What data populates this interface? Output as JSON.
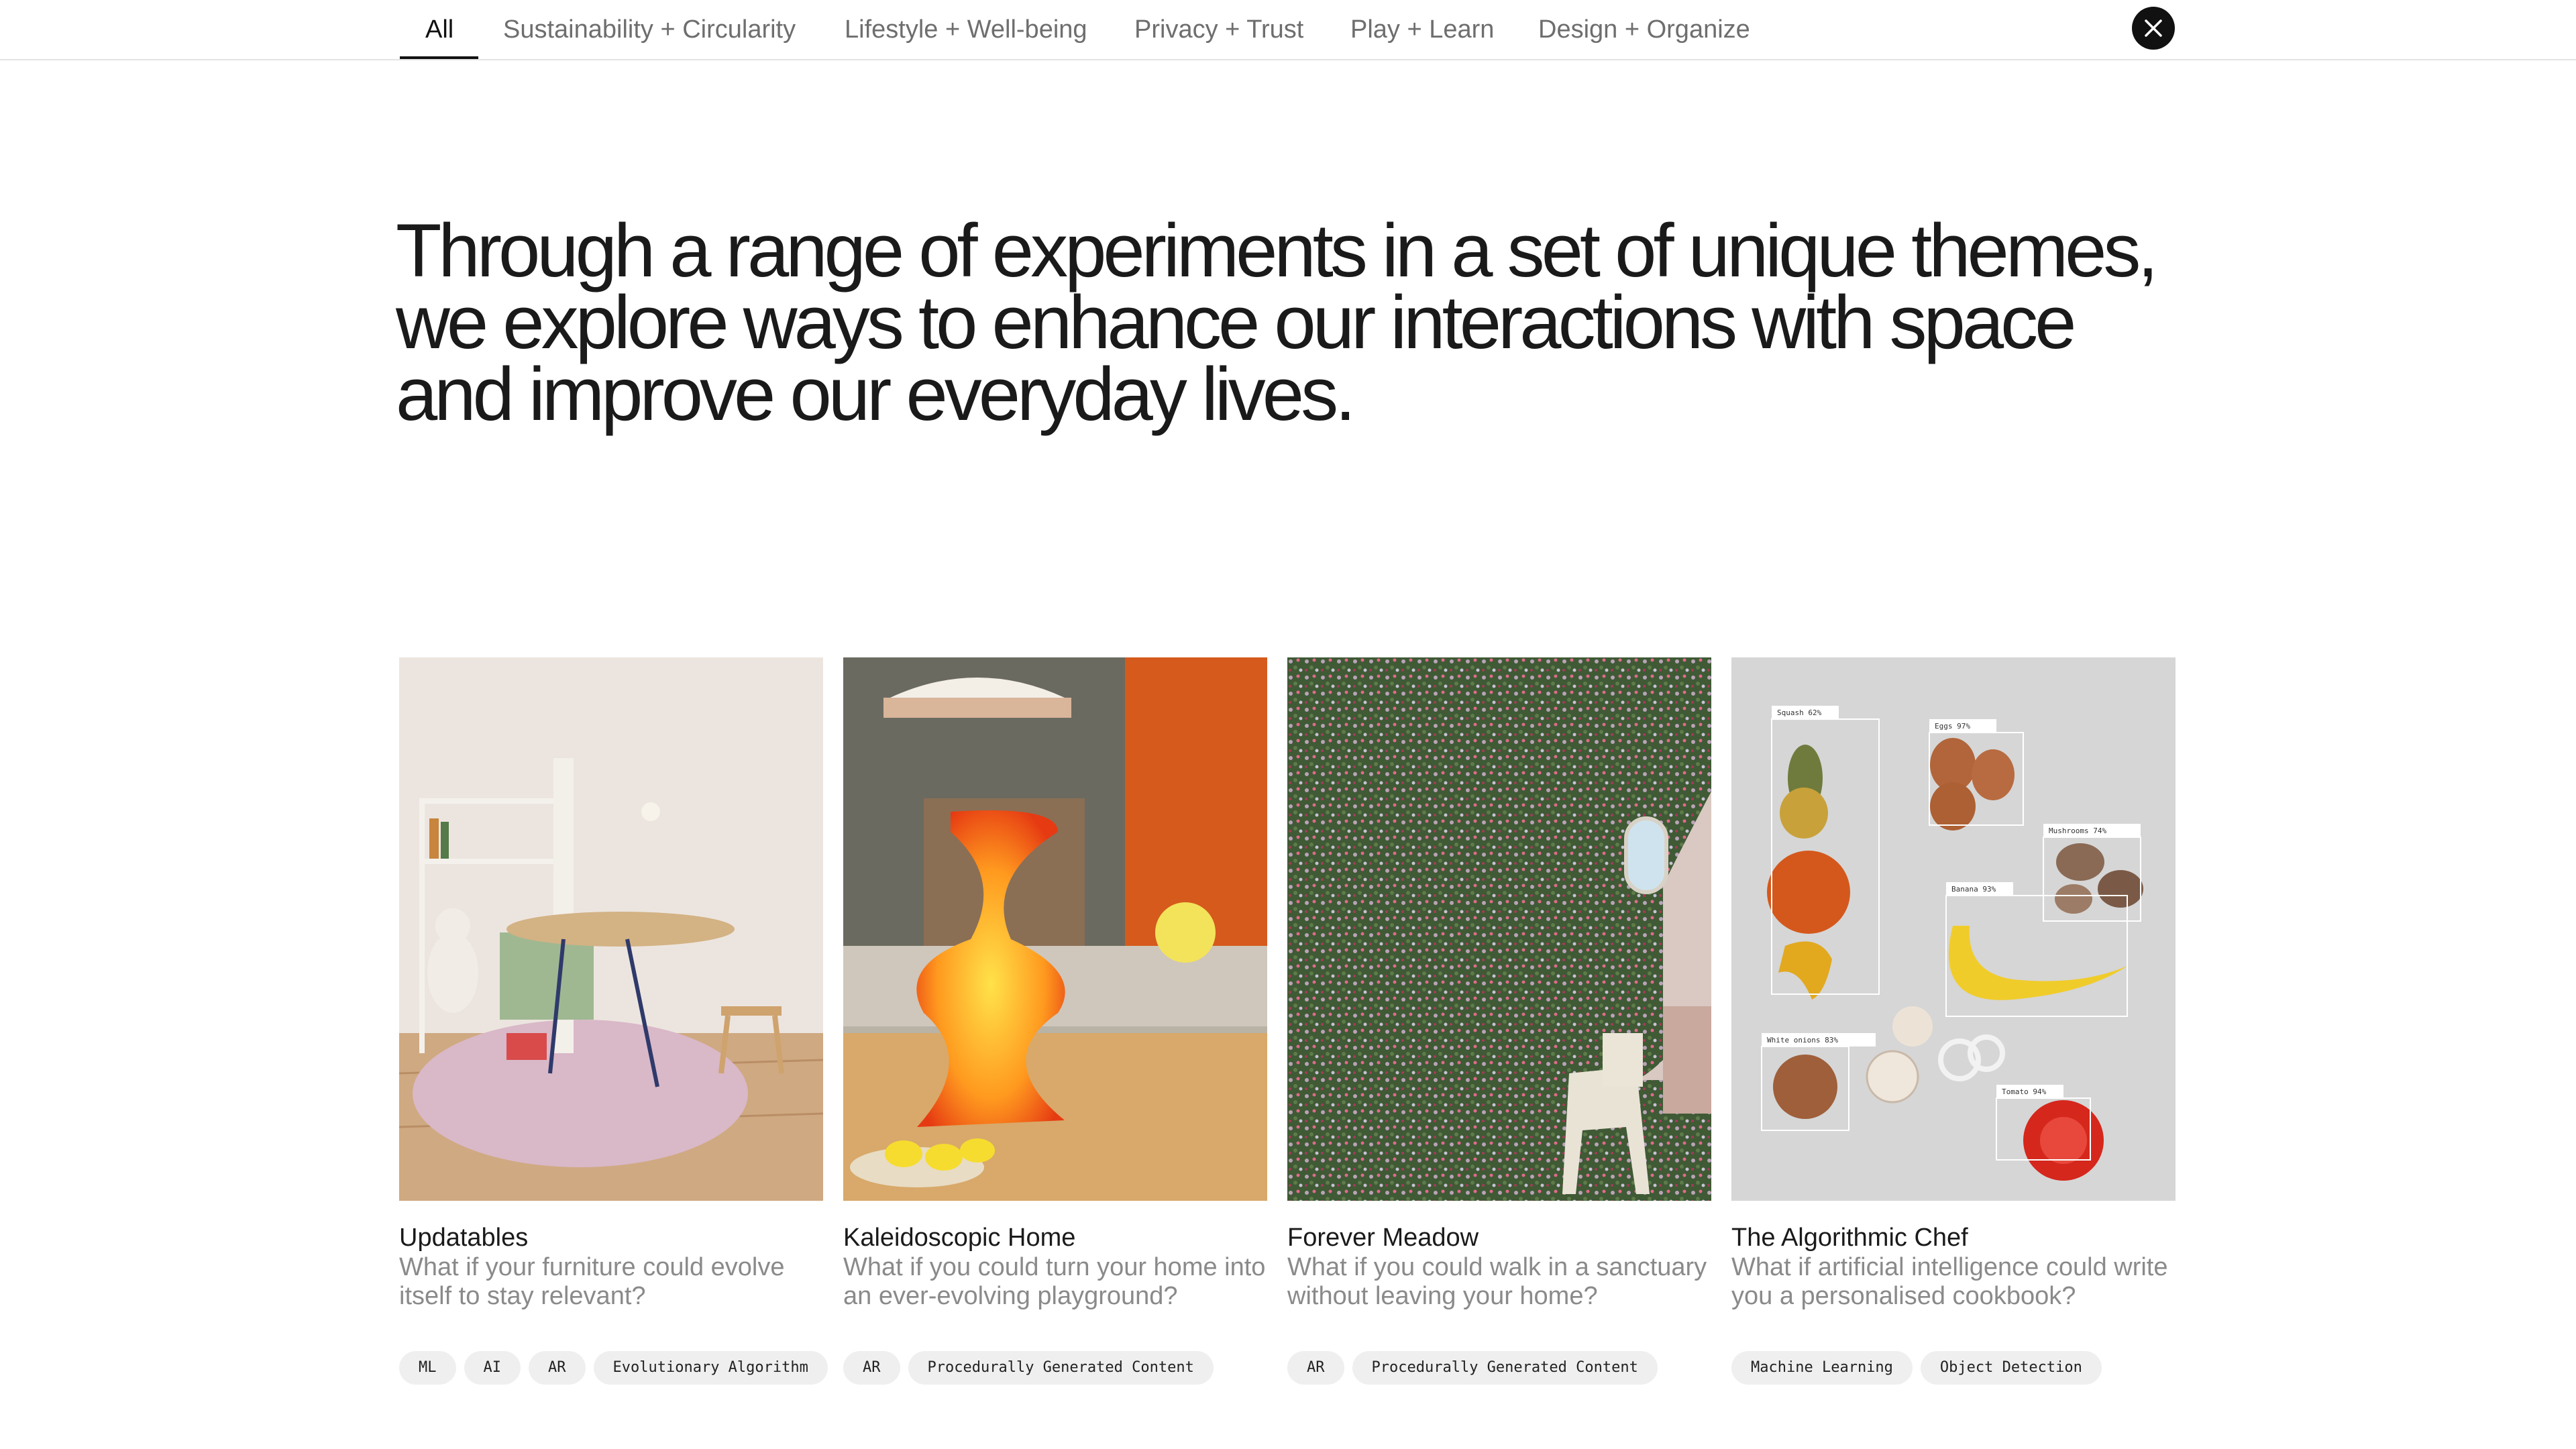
{
  "nav": {
    "tabs": [
      {
        "label": "All"
      },
      {
        "label": "Sustainability + Circularity"
      },
      {
        "label": "Lifestyle + Well-being"
      },
      {
        "label": "Privacy + Trust"
      },
      {
        "label": "Play + Learn"
      },
      {
        "label": "Design + Organize"
      }
    ],
    "active_tab": "All",
    "close_icon": "close-icon"
  },
  "hero": {
    "text": "Through a range of experiments in a set of unique themes, we explore ways to enhance our interactions with space and improve our everyday lives."
  },
  "cards": [
    {
      "title": "Updatables",
      "description": "What if your furniture could evolve itself to stay relevant?",
      "tags": [
        "ML",
        "AI",
        "AR",
        "Evolutionary Algorithm"
      ]
    },
    {
      "title": "Kaleidoscopic Home",
      "description": "What if you could turn your home into an ever-evolving playground?",
      "tags": [
        "AR",
        "Procedurally Generated Content"
      ]
    },
    {
      "title": "Forever Meadow",
      "description": "What if you could walk in a sanctuary without leaving your home?",
      "tags": [
        "AR",
        "Procedurally Generated Content"
      ]
    },
    {
      "title": "The Algorithmic Chef",
      "description": "What if artificial intelligence could write you a personalised cookbook?",
      "tags": [
        "Machine Learning",
        "Object Detection"
      ],
      "detections": [
        "Squash 62%",
        "Eggs 97%",
        "Mushrooms 74%",
        "Banana 93%",
        "White onions 83%",
        "Tomato 94%"
      ]
    }
  ],
  "colors": {
    "accent": "#111111",
    "muted_text": "#8a8a8a",
    "tag_bg": "#efefef",
    "divider": "#e3e3e3"
  }
}
